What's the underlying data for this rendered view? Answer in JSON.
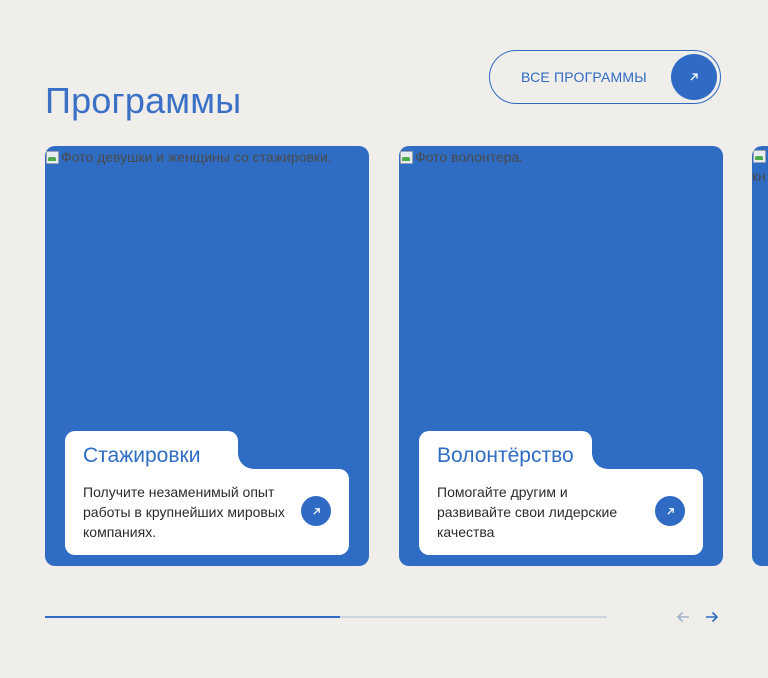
{
  "section": {
    "title": "Программы",
    "all_button_label": "ВСЕ ПРОГРАММЫ"
  },
  "cards": [
    {
      "image_alt": "Фото девушки и женщины со стажировки.",
      "title": "Стажировки",
      "description": "Получите незаменимый опыт работы в крупнейших мировых компаниях.",
      "icon": "arrow-up-right-icon"
    },
    {
      "image_alt": "Фото волонтера.",
      "title": "Волонтёрство",
      "description": "Помогайте другим и развивайте свои лидерские качества",
      "icon": "arrow-up-right-icon"
    },
    {
      "image_alt_partial": "кн"
    }
  ],
  "carousel": {
    "progress_percent": 52.5,
    "prev_icon": "arrow-left-icon",
    "next_icon": "arrow-right-icon"
  },
  "colors": {
    "accent": "#2f6bc4",
    "card_bg": "#2f6dc4",
    "page_bg": "#efeeea"
  }
}
